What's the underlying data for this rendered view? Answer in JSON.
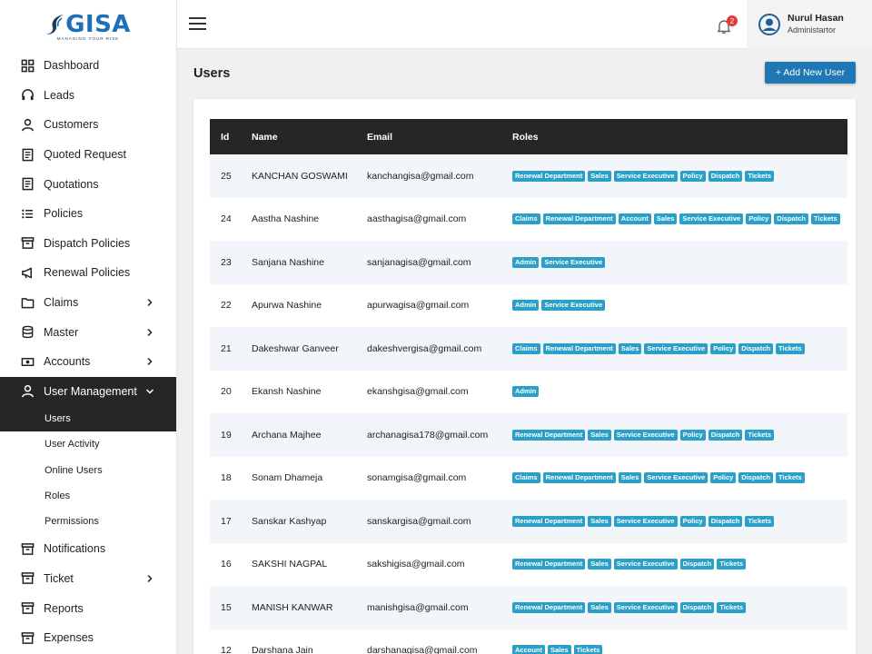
{
  "brand": {
    "logo_text": "GISA",
    "tagline": "MANAGING YOUR RISK"
  },
  "sidebar": {
    "items": [
      {
        "label": "Dashboard",
        "icon": "grid-icon"
      },
      {
        "label": "Leads",
        "icon": "headset-icon"
      },
      {
        "label": "Customers",
        "icon": "person-icon"
      },
      {
        "label": "Quoted Request",
        "icon": "document-icon"
      },
      {
        "label": "Quotations",
        "icon": "document-icon"
      },
      {
        "label": "Policies",
        "icon": "list-icon"
      },
      {
        "label": "Dispatch Policies",
        "icon": "archive-icon"
      },
      {
        "label": "Renewal Policies",
        "icon": "megaphone-icon"
      },
      {
        "label": "Claims",
        "icon": "folder-icon"
      },
      {
        "label": "Master",
        "icon": "database-icon"
      },
      {
        "label": "Accounts",
        "icon": "money-icon"
      },
      {
        "label": "User Management",
        "icon": "person-icon"
      }
    ],
    "user_management_sub": [
      "Users",
      "User Activity",
      "Online Users",
      "Roles",
      "Permissions"
    ],
    "items_after": [
      {
        "label": "Notifications",
        "icon": "archive-icon"
      },
      {
        "label": "Ticket",
        "icon": "archive-icon"
      },
      {
        "label": "Reports",
        "icon": "archive-icon"
      },
      {
        "label": "Expenses",
        "icon": "archive-icon"
      }
    ]
  },
  "header": {
    "notification_count": "2",
    "user_name": "Nurul Hasan",
    "user_role": "Administartor"
  },
  "page": {
    "title": "Users",
    "add_button": "+ Add New User"
  },
  "table": {
    "columns": [
      "Id",
      "Name",
      "Email",
      "Roles"
    ],
    "rows": [
      {
        "id": "25",
        "name": "KANCHAN GOSWAMI",
        "email": "kanchangisa@gmail.com",
        "roles": [
          "Renewal Department",
          "Sales",
          "Service Executive",
          "Policy",
          "Dispatch",
          "Tickets"
        ]
      },
      {
        "id": "24",
        "name": "Aastha Nashine",
        "email": "aasthagisa@gmail.com",
        "roles": [
          "Claims",
          "Renewal Department",
          "Account",
          "Sales",
          "Service Executive",
          "Policy",
          "Dispatch",
          "Tickets"
        ]
      },
      {
        "id": "23",
        "name": "Sanjana Nashine",
        "email": "sanjanagisa@gmail.com",
        "roles": [
          "Admin",
          "Service Executive"
        ]
      },
      {
        "id": "22",
        "name": "Apurwa Nashine",
        "email": "apurwagisa@gmail.com",
        "roles": [
          "Admin",
          "Service Executive"
        ]
      },
      {
        "id": "21",
        "name": "Dakeshwar Ganveer",
        "email": "dakeshvergisa@gmail.com",
        "roles": [
          "Claims",
          "Renewal Department",
          "Sales",
          "Service Executive",
          "Policy",
          "Dispatch",
          "Tickets"
        ]
      },
      {
        "id": "20",
        "name": "Ekansh Nashine",
        "email": "ekanshgisa@gmail.com",
        "roles": [
          "Admin"
        ]
      },
      {
        "id": "19",
        "name": "Archana Majhee",
        "email": "archanagisa178@gmail.com",
        "roles": [
          "Renewal Department",
          "Sales",
          "Service Executive",
          "Policy",
          "Dispatch",
          "Tickets"
        ]
      },
      {
        "id": "18",
        "name": "Sonam Dhameja",
        "email": "sonamgisa@gmail.com",
        "roles": [
          "Claims",
          "Renewal Department",
          "Sales",
          "Service Executive",
          "Policy",
          "Dispatch",
          "Tickets"
        ]
      },
      {
        "id": "17",
        "name": "Sanskar Kashyap",
        "email": "sanskargisa@gmail.com",
        "roles": [
          "Renewal Department",
          "Sales",
          "Service Executive",
          "Policy",
          "Dispatch",
          "Tickets"
        ]
      },
      {
        "id": "16",
        "name": "SAKSHI NAGPAL",
        "email": "sakshigisa@gmail.com",
        "roles": [
          "Renewal Department",
          "Sales",
          "Service Executive",
          "Dispatch",
          "Tickets"
        ]
      },
      {
        "id": "15",
        "name": "MANISH KANWAR",
        "email": "manishgisa@gmail.com",
        "roles": [
          "Renewal Department",
          "Sales",
          "Service Executive",
          "Dispatch",
          "Tickets"
        ]
      },
      {
        "id": "12",
        "name": "Darshana Jain",
        "email": "darshanagisa@gmail.com",
        "roles": [
          "Account",
          "Sales",
          "Tickets"
        ]
      }
    ]
  },
  "colors": {
    "accent": "#1f78b4",
    "role_badge": "#2aa0c8",
    "dark": "#262626",
    "notification": "#e53935"
  }
}
